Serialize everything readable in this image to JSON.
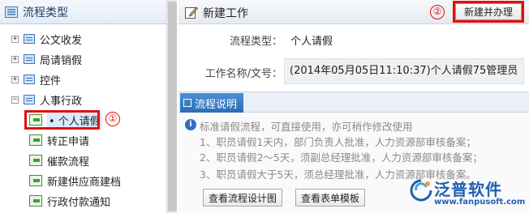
{
  "left_panel": {
    "title": "流程类型",
    "tree": [
      {
        "label": "公文收发",
        "expander": "+",
        "type": "folder"
      },
      {
        "label": "局请销假",
        "expander": "+",
        "type": "folder"
      },
      {
        "label": "控件",
        "expander": "+",
        "type": "folder"
      },
      {
        "label": "人事行政",
        "expander": "−",
        "type": "folder"
      },
      {
        "label": "• 个人请假",
        "type": "flow",
        "selected": true
      },
      {
        "label": "转正申请",
        "type": "flow"
      },
      {
        "label": "催款流程",
        "type": "flow"
      },
      {
        "label": "新建供应商建档",
        "type": "flow"
      },
      {
        "label": "行政付款通知",
        "type": "flow"
      }
    ],
    "annotation_1": "①"
  },
  "right_panel": {
    "title": "新建工作",
    "new_button_label": "新建并办理",
    "annotation_2": "②",
    "fields": {
      "type_label": "流程类型：",
      "type_value": "个人请假",
      "name_label": "工作名称/文号：",
      "name_value": "(2014年05月05日11:10:37)个人请假75管理员"
    },
    "section": {
      "tab_label": "流程说明",
      "description": [
        "标准请假流程，可直接使用，亦可稍作修改使用",
        "1、职员请假1天内，部门负责人批准，人力资源部审核备案；",
        "2、职员请假2～5天，须副总经理批准，人力资源部审核备案；",
        "3、职员请假大于5天，须总经理批准，人力资源部审核备案。"
      ],
      "buttons": [
        "查看流程设计图",
        "查看表单模板"
      ]
    }
  },
  "logo": {
    "name": "泛普软件",
    "url": "www.fanpusoft.com"
  },
  "colors": {
    "highlight_red": "#e01010",
    "tab_blue": "#2c6db5",
    "brand_blue": "#2060b0"
  }
}
